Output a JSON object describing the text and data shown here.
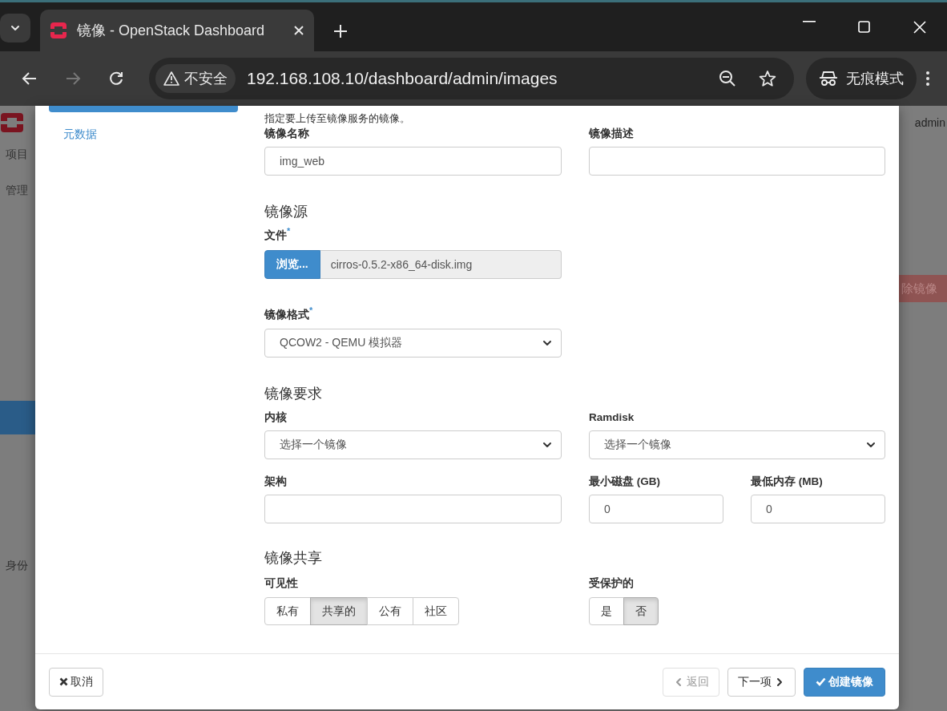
{
  "browser": {
    "tab_title": "镜像 - OpenStack Dashboard",
    "security_label": "不安全",
    "url": "192.168.108.10/dashboard/admin/images",
    "profile_label": "无痕模式"
  },
  "backdrop": {
    "user": "admin",
    "sidebar_items": [
      "项目",
      "管理",
      "身份"
    ],
    "action_button": "除镜像"
  },
  "modal": {
    "nav_items": [
      {
        "label": "元数据",
        "selected": false
      }
    ],
    "intro": "指定要上传至镜像服务的镜像。",
    "name": {
      "label": "镜像名称",
      "value": "img_web"
    },
    "description": {
      "label": "镜像描述"
    },
    "source": {
      "heading": "镜像源",
      "file": {
        "label": "文件",
        "required_mark": "*",
        "browse_button": "浏览...",
        "file_name": "cirros-0.5.2-x86_64-disk.img"
      },
      "format": {
        "label": "镜像格式",
        "required_mark": "*",
        "value": "QCOW2 - QEMU 模拟器"
      }
    },
    "requirements": {
      "heading": "镜像要求",
      "kernel": {
        "label": "内核",
        "value": "选择一个镜像"
      },
      "ramdisk": {
        "label": "Ramdisk",
        "value": "选择一个镜像"
      },
      "architecture": {
        "label": "架构"
      },
      "min_disk": {
        "label": "最小磁盘 (GB)",
        "value": "0"
      },
      "min_ram": {
        "label": "最低内存 (MB)",
        "value": "0"
      }
    },
    "sharing": {
      "heading": "镜像共享",
      "visibility": {
        "label": "可见性",
        "options": [
          {
            "label": "私有",
            "selected": false
          },
          {
            "label": "共享的",
            "selected": true
          },
          {
            "label": "公有",
            "selected": false
          },
          {
            "label": "社区",
            "selected": false
          }
        ]
      },
      "protected": {
        "label": "受保护的",
        "options": [
          {
            "label": "是",
            "selected": false
          },
          {
            "label": "否",
            "selected": true
          }
        ]
      }
    },
    "footer": {
      "cancel": "取消",
      "back": {
        "label": "返回",
        "disabled": true
      },
      "next": "下一项",
      "create": "创建镜像"
    }
  }
}
